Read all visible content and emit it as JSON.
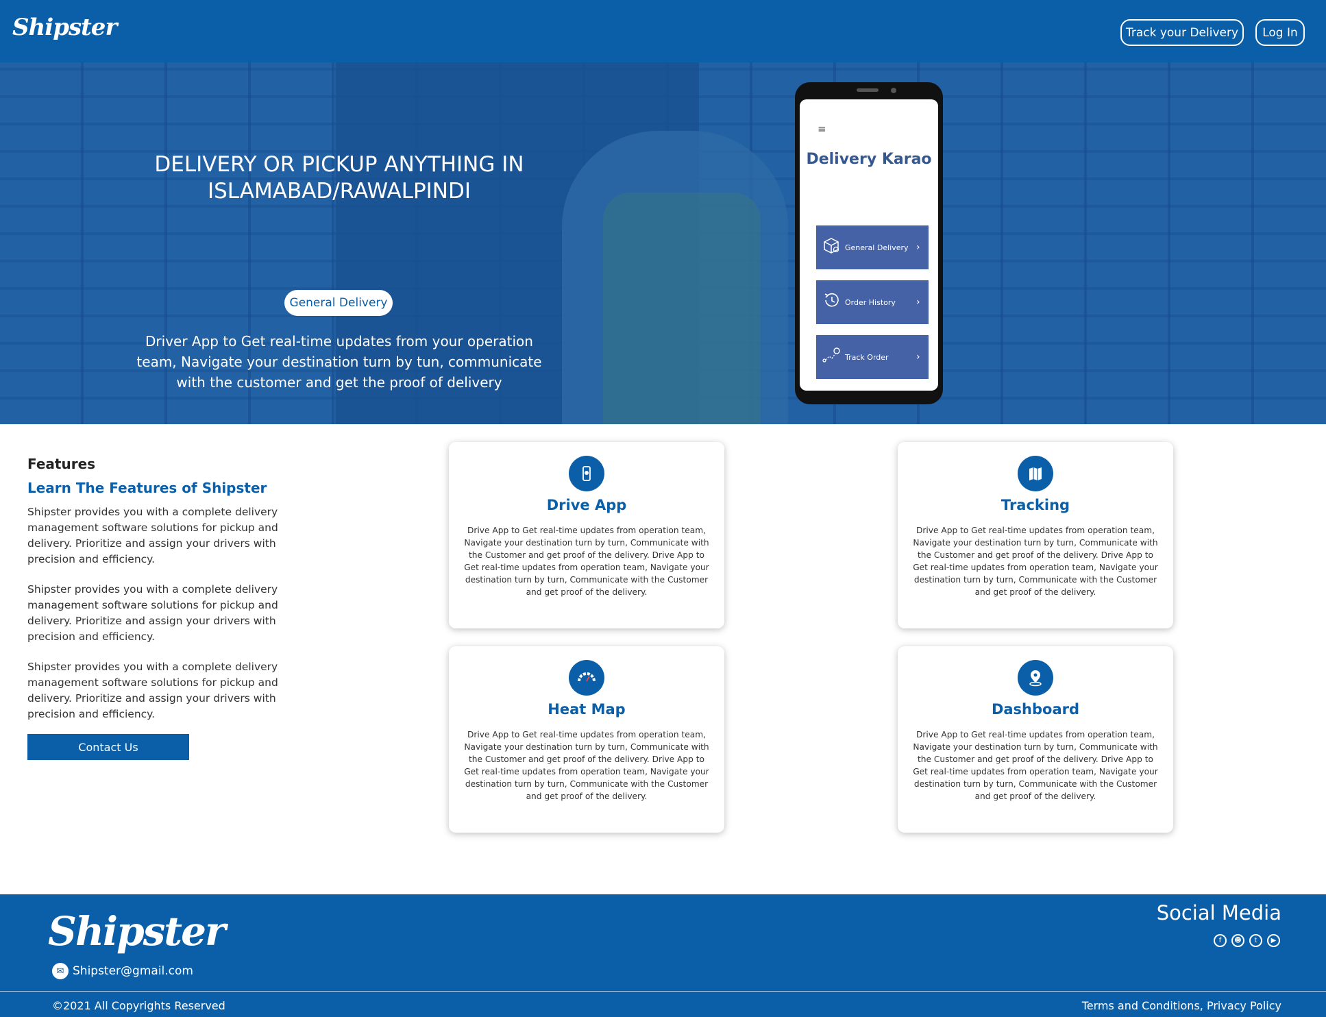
{
  "header": {
    "brand": "Shipster",
    "track_label": "Track your Delivery",
    "login_label": "Log In"
  },
  "hero": {
    "title": "DELIVERY OR PICKUP ANYTHING IN ISLAMABAD/RAWALPINDI",
    "pill_label": "General Delivery",
    "description": "Driver App to Get real-time updates from your operation team, Navigate your destination turn by tun, communicate with the customer and get the proof of delivery"
  },
  "phone": {
    "menu_icon": "≡",
    "title": "Delivery Karao",
    "buttons": [
      {
        "label": "General Delivery",
        "icon": "box-icon"
      },
      {
        "label": "Order History",
        "icon": "history-icon"
      },
      {
        "label": "Track Order",
        "icon": "route-icon"
      }
    ]
  },
  "features": {
    "heading": "Features",
    "subheading": "Learn The Features of Shipster",
    "paragraphs": [
      "Shipster provides you with a complete delivery management software solutions for pickup and delivery. Prioritize and assign your drivers with precision and efficiency.",
      "Shipster provides you with a complete delivery management software solutions for pickup and delivery. Prioritize and assign your drivers with precision and efficiency.",
      "Shipster provides you with a complete delivery management software solutions for pickup and delivery. Prioritize and assign your drivers with precision and efficiency."
    ],
    "contact_label": "Contact Us",
    "cards": [
      {
        "title": "Drive App",
        "icon": "phone-icon",
        "text": "Drive App to Get real-time updates from operation team, Navigate your destination turn by turn, Communicate with the Customer and get proof of the delivery. Drive App to Get real-time updates from operation team, Navigate your destination turn by turn, Communicate with the Customer and get proof of the delivery."
      },
      {
        "title": "Tracking",
        "icon": "map-icon",
        "text": "Drive App to Get real-time updates from operation team, Navigate your destination turn by turn, Communicate with the Customer and get proof of the delivery. Drive App to Get real-time updates from operation team, Navigate your destination turn by turn, Communicate with the Customer and get proof of the delivery."
      },
      {
        "title": "Heat Map",
        "icon": "gauge-icon",
        "text": "Drive App to Get real-time updates from operation team, Navigate your destination turn by turn, Communicate with the Customer and get proof of the delivery. Drive App to Get real-time updates from operation team, Navigate your destination turn by turn, Communicate with the Customer and get proof of the delivery."
      },
      {
        "title": "Dashboard",
        "icon": "location-pin-icon",
        "text": "Drive App to Get real-time updates from operation team, Navigate your destination turn by turn, Communicate with the Customer and get proof of the delivery. Drive App to Get real-time updates from operation team, Navigate your destination turn by turn, Communicate with the Customer and get proof of the delivery."
      }
    ]
  },
  "footer": {
    "brand": "Shipster",
    "email": "Shipster@gmail.com",
    "social_heading": "Social Media",
    "social_icons": [
      "facebook-icon",
      "reddit-icon",
      "twitter-icon",
      "youtube-icon"
    ],
    "copyright": "©2021 All Copyrights Reserved",
    "terms": "Terms and Conditions, Privacy Policy"
  },
  "colors": {
    "brand_blue": "#0b5fa8",
    "phone_button": "#4662a6",
    "phone_title": "#355891"
  }
}
